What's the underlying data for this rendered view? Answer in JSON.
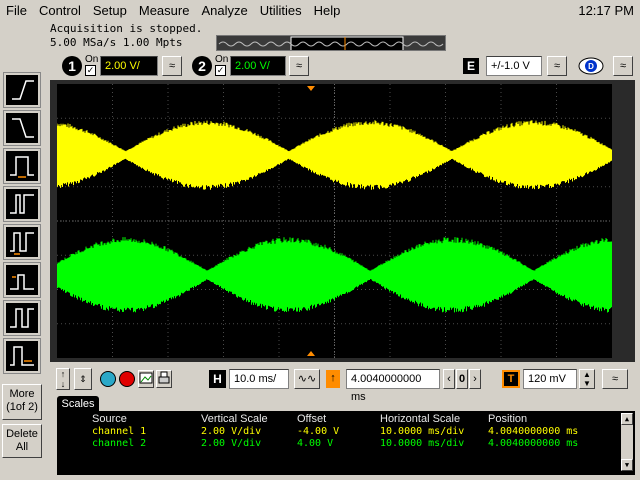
{
  "menu": [
    "File",
    "Control",
    "Setup",
    "Measure",
    "Analyze",
    "Utilities",
    "Help"
  ],
  "clock": "12:17 PM",
  "status": {
    "line1": "Acquisition is stopped.",
    "line2": "5.00 MSa/s   1.00 Mpts"
  },
  "channels": [
    {
      "number": "1",
      "on_label": "On",
      "scale": "2.00 V/",
      "color": "#ffff00"
    },
    {
      "number": "2",
      "on_label": "On",
      "scale": "2.00 V/",
      "color": "#00ff00"
    }
  ],
  "trigger_source": {
    "label": "E",
    "value": "+/-1.0 V"
  },
  "left_toolbar": {
    "more_label": "More",
    "more_page": "(1of 2)",
    "delete_label": "Delete",
    "delete_all": "All"
  },
  "horizontal": {
    "h_label": "H",
    "timebase": "10.0 ms/",
    "position": "4.0040000000 ms",
    "trigger_label": "T",
    "trigger_level": "120 mV"
  },
  "scales": {
    "tab": "Scales",
    "headers": [
      "Source",
      "Vertical Scale",
      "Offset",
      "Horizontal Scale",
      "Position"
    ],
    "rows": [
      {
        "source": "channel 1",
        "vscale": "2.00 V/div",
        "offset": "-4.00 V",
        "hscale": "10.0000 ms/div",
        "position": "4.0040000000 ms"
      },
      {
        "source": "channel 2",
        "vscale": "2.00 V/div",
        "offset": "4.00 V",
        "hscale": "10.0000 ms/div",
        "position": "4.0040000000 ms"
      }
    ]
  },
  "waveform_markers": {
    "ch1": "1",
    "ch2": "2",
    "trigger": "T"
  }
}
